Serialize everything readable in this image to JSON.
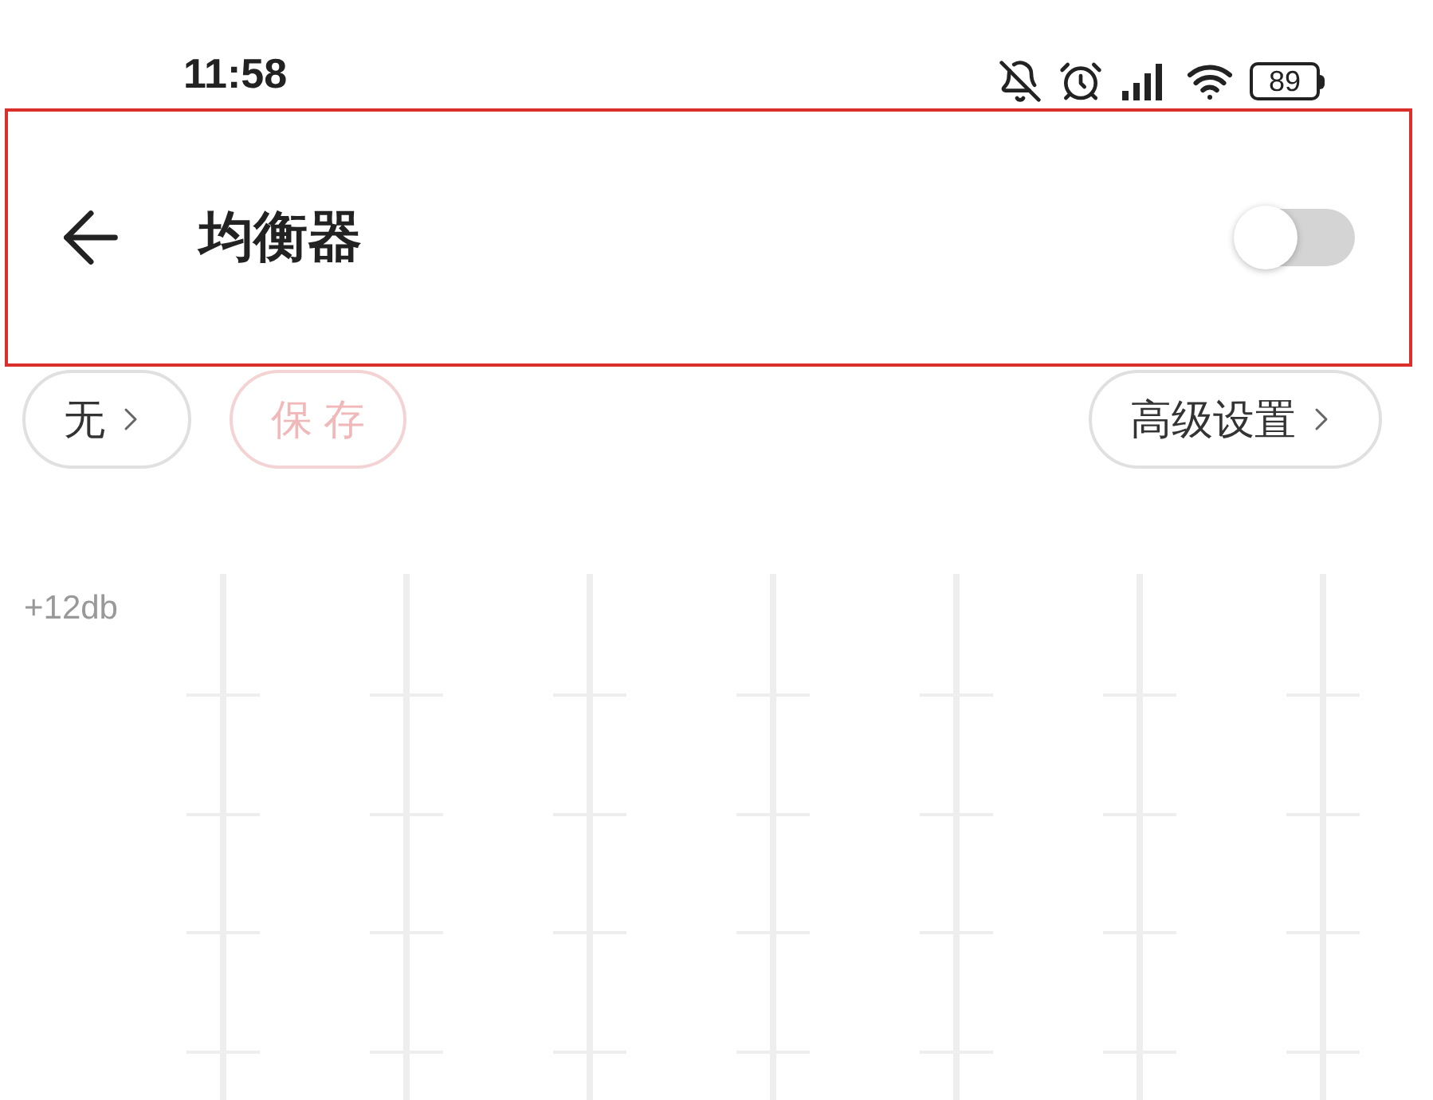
{
  "status_bar": {
    "time": "11:58",
    "battery": "89"
  },
  "header": {
    "title": "均衡器",
    "switch": {
      "on": false
    }
  },
  "buttons": [
    {
      "label": "无",
      "kind": "preset"
    },
    {
      "label": "保 存",
      "kind": "save"
    },
    {
      "label": "高级设置",
      "kind": "advanced"
    }
  ],
  "equalizer": {
    "top_label": "+12db"
  }
}
